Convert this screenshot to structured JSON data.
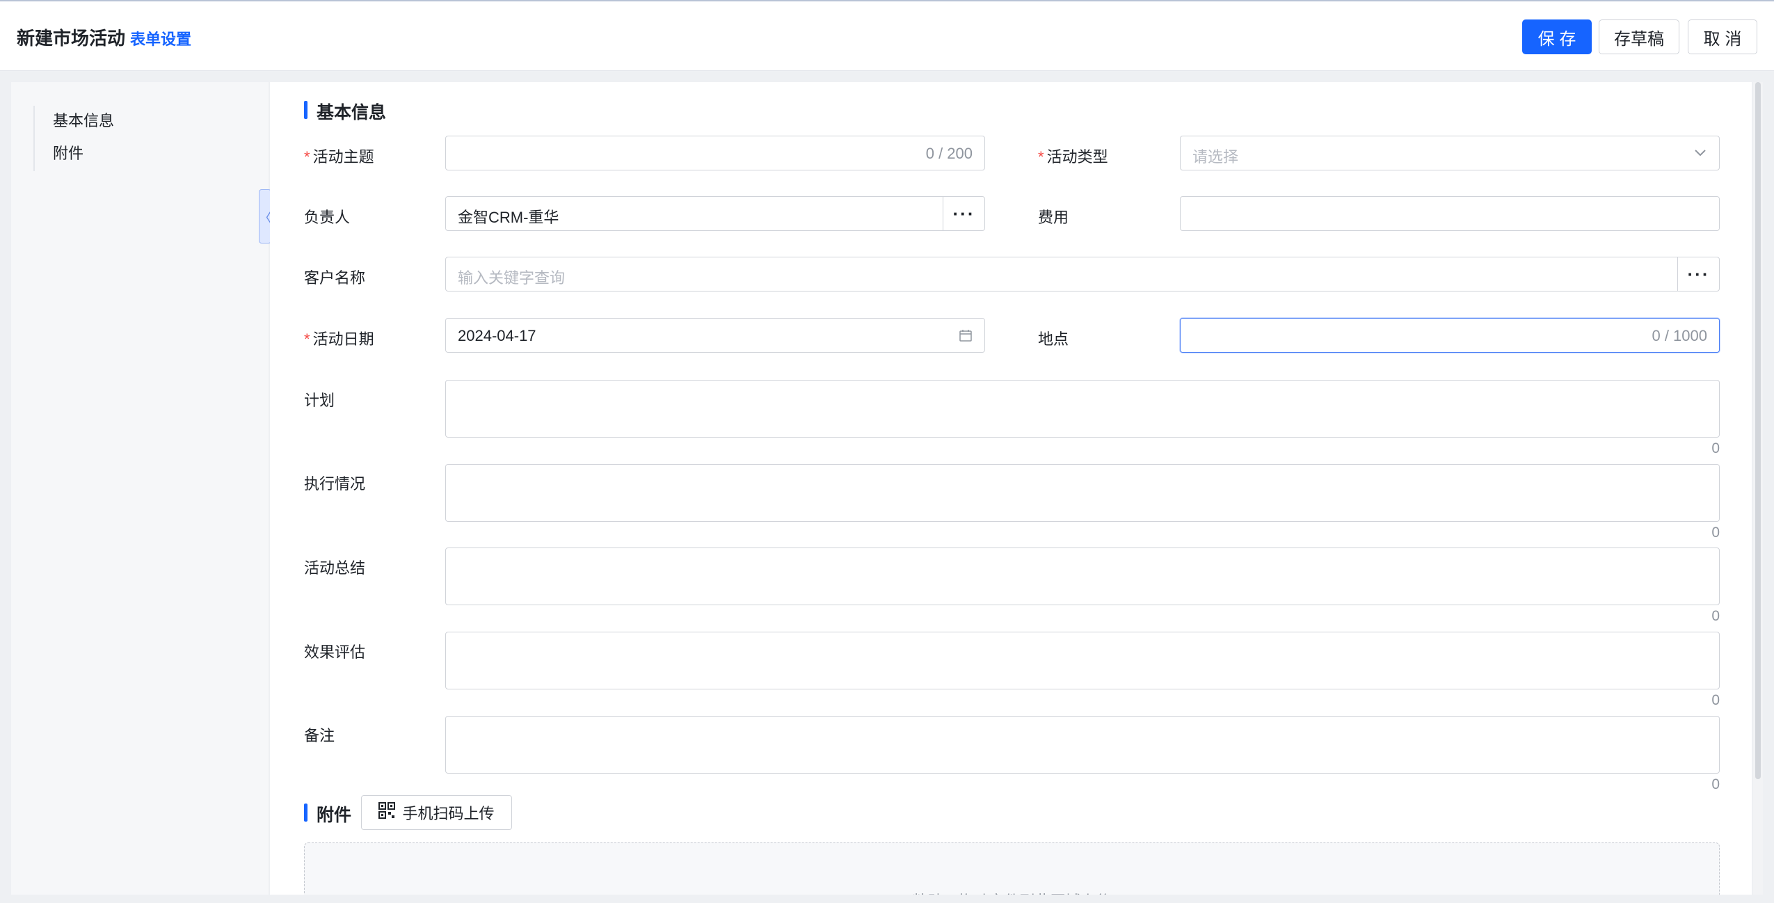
{
  "header": {
    "title": "新建市场活动",
    "form_settings": "表单设置",
    "save": "保 存",
    "draft": "存草稿",
    "cancel": "取 消"
  },
  "sidebar": {
    "items": [
      {
        "label": "基本信息"
      },
      {
        "label": "附件"
      }
    ]
  },
  "form": {
    "section_basic": "基本信息",
    "topic": {
      "label": "活动主题",
      "value": "",
      "count": "0 / 200"
    },
    "type": {
      "label": "活动类型",
      "placeholder": "请选择"
    },
    "owner": {
      "label": "负责人",
      "value": "金智CRM-重华"
    },
    "cost": {
      "label": "费用",
      "value": ""
    },
    "customer": {
      "label": "客户名称",
      "placeholder": "输入关键字查询"
    },
    "date": {
      "label": "活动日期",
      "value": "2024-04-17"
    },
    "location": {
      "label": "地点",
      "value": "",
      "count": "0 / 1000"
    },
    "textareas": [
      {
        "label": "计划",
        "count": "0"
      },
      {
        "label": "执行情况",
        "count": "0"
      },
      {
        "label": "活动总结",
        "count": "0"
      },
      {
        "label": "效果评估",
        "count": "0"
      },
      {
        "label": "备注",
        "count": "0"
      }
    ],
    "more_glyph": "···",
    "required_mark": "*"
  },
  "attachments": {
    "section_title": "附件",
    "scan_upload": "手机扫码上传",
    "dropzone_text": "粘贴、拖动文件到此区域上传"
  },
  "colors": {
    "accent": "#1664ff",
    "required": "#f54a45",
    "border": "#d0d3d9"
  }
}
